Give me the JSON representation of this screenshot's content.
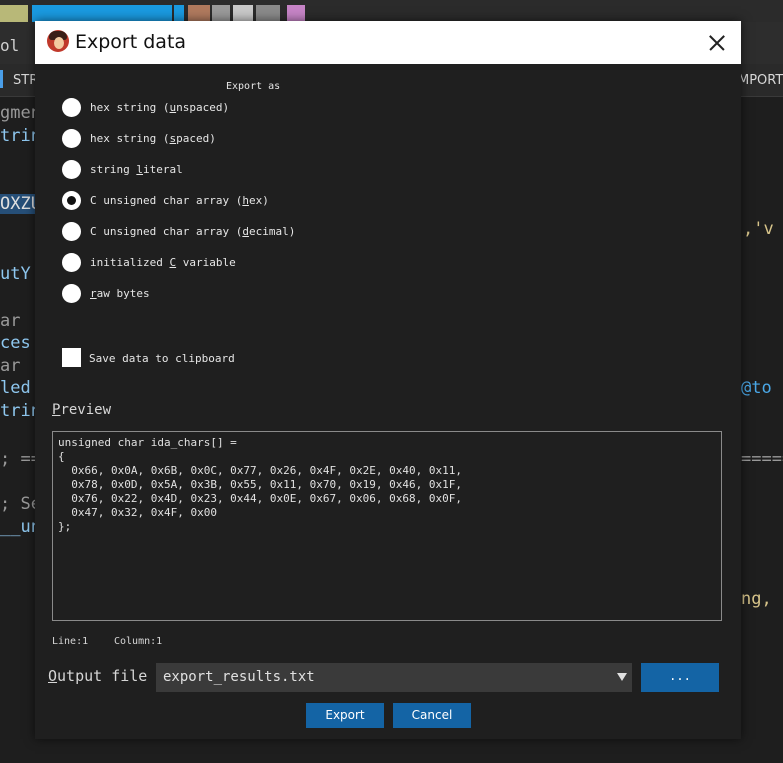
{
  "background": {
    "menubar_tool": "ol",
    "tab_left": "STR",
    "tab_right": "MPORTS",
    "code_left": [
      "gmen",
      "trin",
      "OXZU",
      "utY",
      "ar",
      "ces",
      "ar",
      "led",
      "trin",
      "; ==",
      "; Se",
      "__un"
    ],
    "code_right": [
      ",'v",
      "@to",
      "=====",
      "ng, s"
    ]
  },
  "dialog": {
    "title": "Export data",
    "export_group_label": "Export as",
    "options": [
      {
        "pre": "hex string (",
        "key": "u",
        "post": "nspaced)",
        "checked": false
      },
      {
        "pre": "hex string (",
        "key": "s",
        "post": "paced)",
        "checked": false
      },
      {
        "pre": "string ",
        "key": "l",
        "post": "iteral",
        "checked": false
      },
      {
        "pre": "C unsigned char array (",
        "key": "h",
        "post": "ex)",
        "checked": true
      },
      {
        "pre": "C unsigned char array (",
        "key": "d",
        "post": "ecimal)",
        "checked": false
      },
      {
        "pre": "initialized ",
        "key": "C",
        "post": " variable",
        "checked": false
      },
      {
        "pre": "",
        "key": "r",
        "post": "aw bytes",
        "checked": false
      }
    ],
    "clipboard_label": "Save data to clipboard",
    "clipboard_checked": false,
    "preview_label": "Preview",
    "preview_text": "unsigned char ida_chars[] =\n{\n  0x66, 0x0A, 0x6B, 0x0C, 0x77, 0x26, 0x4F, 0x2E, 0x40, 0x11,\n  0x78, 0x0D, 0x5A, 0x3B, 0x55, 0x11, 0x70, 0x19, 0x46, 0x1F,\n  0x76, 0x22, 0x4D, 0x23, 0x44, 0x0E, 0x67, 0x06, 0x68, 0x0F,\n  0x47, 0x32, 0x4F, 0x00\n};",
    "status_line": "Line:1",
    "status_column": "Column:1",
    "output_label": "Output file",
    "output_value": "export_results.txt",
    "browse_label": "...",
    "export_button": "Export",
    "cancel_button": "Cancel"
  },
  "colors": {
    "accent": "#1464a5",
    "titlebar": "#ffffff",
    "dialog_bg": "#1f1f1f"
  }
}
